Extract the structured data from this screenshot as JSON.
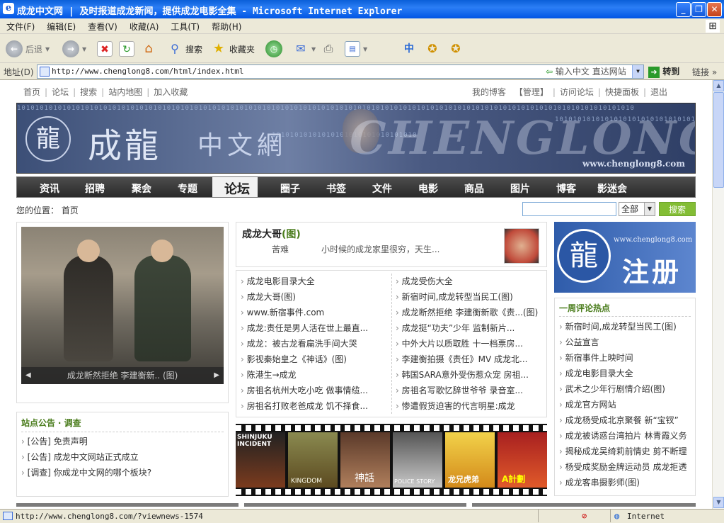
{
  "window": {
    "title": "成龙中文网 | 及时报道成龙新闻，提供成龙电影全集 - Microsoft Internet Explorer",
    "menu": [
      "文件(F)",
      "编辑(E)",
      "查看(V)",
      "收藏(A)",
      "工具(T)",
      "帮助(H)"
    ],
    "toolbar": {
      "back": "后退",
      "search": "搜索",
      "favorites": "收藏夹"
    },
    "address_label": "地址(D)",
    "url": "http://www.chenglong8.com/html/index.html",
    "address_hint": "输入中文 直达网站",
    "go": "转到",
    "links": "链接"
  },
  "status": {
    "url": "http://www.chenglong8.com/?viewnews-1574",
    "zone": "Internet"
  },
  "page": {
    "toplinks_left": [
      "首页",
      "论坛",
      "搜索",
      "站内地图",
      "加入收藏"
    ],
    "toplinks_right": [
      "我的博客",
      "【管理】",
      "访问论坛",
      "快捷面板",
      "退出"
    ],
    "banner": {
      "logo_char": "龍",
      "name": "成龍",
      "cn": "中文網",
      "big": "CHENGLONG",
      "url": "www.chenglong8.com"
    },
    "nav": [
      "资讯",
      "招聘",
      "聚会",
      "专题",
      "论坛",
      "圈子",
      "书签",
      "文件",
      "电影",
      "商品",
      "图片",
      "博客",
      "影迷会"
    ],
    "location_label": "您的位置：",
    "location_value": "首页",
    "search_scope": "全部",
    "search_button": "搜索",
    "photo_caption": "成龙断然拒绝 李建衡新.. (图)",
    "feature": {
      "title": "成龙大哥",
      "tag": "(图)",
      "author": "苦难",
      "summary": "小时候的成龙家里很穷，天生..."
    },
    "news_left": [
      "成龙电影目录大全",
      "成龙大哥(图)",
      "www.新宿事件.com",
      "成龙:责任是男人活在世上最直...",
      "成龙：被古龙看扁洗手间大哭",
      "影视秦始皇之《神话》(图)",
      "陈港生→成龙",
      "房祖名杭州大吃小吃 做事情缆...",
      "房祖名打败老爸成龙 饥不择食..."
    ],
    "news_right": [
      "成龙受伤大全",
      "新宿时间,成龙转型当民工(图)",
      "成龙断然拒绝 李建衡新歌《责...(图)",
      "成龙挺“功夫”少年 监制新片...",
      "中外大片以质取胜 十一档票房...",
      "李建衡拍摄《责任》MV 成龙北...",
      "韩国SARA意外受伤惹众宠 房祖...",
      "房祖名写歌忆辞世爷爷 录音室...",
      "惨遭假货迫害的代言明星:成龙"
    ],
    "notice_title": "站点公告",
    "notice_title2": "· 调查",
    "notices": [
      "[公告] 免责声明",
      "[公告] 成龙中文网站正式成立",
      "[调查] 你成龙中文网的哪个板块?"
    ],
    "register": {
      "logo_char": "龍",
      "url": "www.chenglong8.com",
      "text": "注册"
    },
    "hot_title": "一周评论热点",
    "hot": [
      "新宿时间,成龙转型当民工(图)",
      "公益宣言",
      "新宿事件上映时间",
      "成龙电影目录大全",
      "武术之少年行剧情介绍(图)",
      "成龙官方网站",
      "成龙杨受成北京聚餐 新“宝钗”",
      "成龙被诱惑台湾拍片 林青霞义务",
      "揭秘成龙吴绮莉前情史 剪不断理",
      "杨受成奖励金牌运动员 成龙拒透",
      "成龙客串摄影师(图)"
    ],
    "film_labels": [
      "SHINJUKU INCIDENT",
      "KINGDOM",
      "神話",
      "POLICE STORY",
      "龙兄虎弟",
      "A計劃"
    ]
  }
}
